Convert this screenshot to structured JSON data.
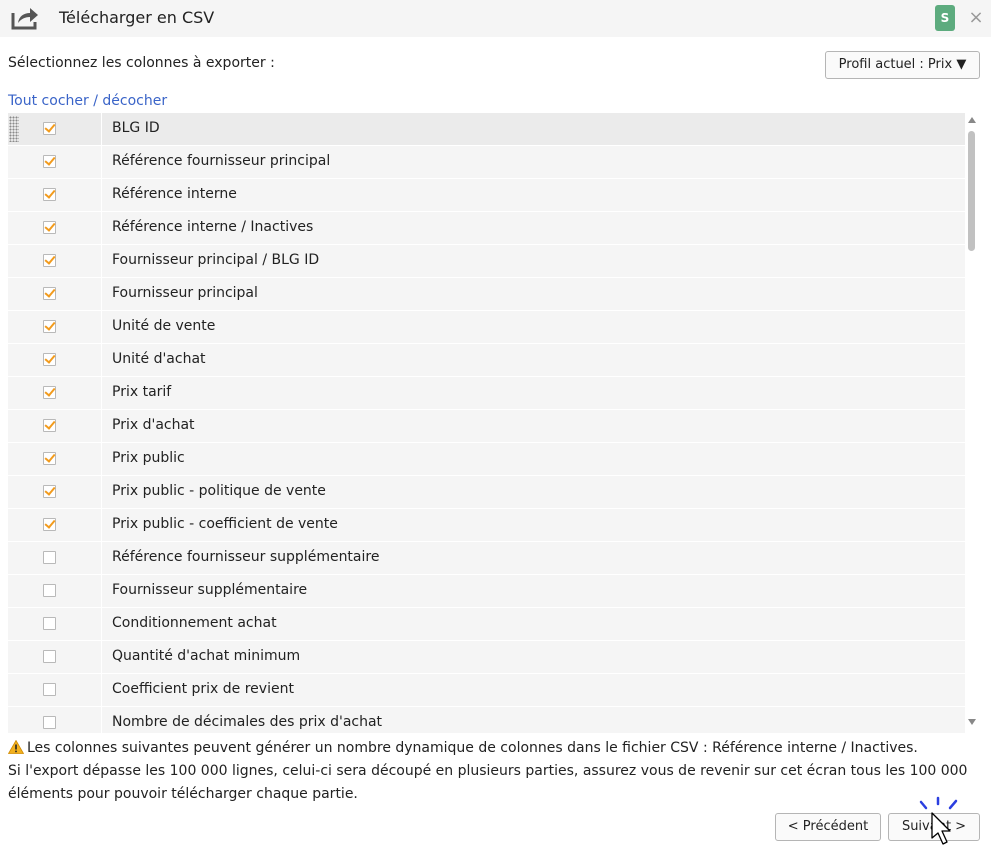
{
  "window": {
    "title": "Télécharger en CSV",
    "user_initial": "S",
    "close_glyph": "×",
    "title_icon": "export-icon",
    "colors": {
      "badge": "#5dab7e",
      "checkbox_check": "#f29b1d",
      "link": "#3a64c8"
    }
  },
  "header": {
    "select_label": "Sélectionnez les colonnes à exporter :",
    "profile_button": "Profil actuel : Prix ▼"
  },
  "toggle_all_link": "Tout cocher / décocher",
  "columns": [
    {
      "label": "BLG ID",
      "checked": true
    },
    {
      "label": "Référence fournisseur principal",
      "checked": true
    },
    {
      "label": "Référence interne",
      "checked": true
    },
    {
      "label": "Référence interne / Inactives",
      "checked": true
    },
    {
      "label": "Fournisseur principal / BLG ID",
      "checked": true
    },
    {
      "label": "Fournisseur principal",
      "checked": true
    },
    {
      "label": "Unité de vente",
      "checked": true
    },
    {
      "label": "Unité d'achat",
      "checked": true
    },
    {
      "label": "Prix tarif",
      "checked": true
    },
    {
      "label": "Prix d'achat",
      "checked": true
    },
    {
      "label": "Prix public",
      "checked": true
    },
    {
      "label": "Prix public - politique de vente",
      "checked": true
    },
    {
      "label": "Prix public - coefficient de vente",
      "checked": true
    },
    {
      "label": "Référence fournisseur supplémentaire",
      "checked": false
    },
    {
      "label": "Fournisseur supplémentaire",
      "checked": false
    },
    {
      "label": "Conditionnement achat",
      "checked": false
    },
    {
      "label": "Quantité d'achat minimum",
      "checked": false
    },
    {
      "label": "Coefficient prix de revient",
      "checked": false
    },
    {
      "label": "Nombre de décimales des prix d'achat",
      "checked": false
    }
  ],
  "warning": {
    "icon": "warning-icon",
    "text": "Les colonnes suivantes peuvent générer un nombre dynamique de colonnes dans le fichier CSV : Référence interne / Inactives."
  },
  "info_text": "Si l'export dépasse les 100 000 lignes, celui-ci sera découpé en plusieurs parties, assurez vous de revenir sur cet écran tous les 100 000 éléments pour pouvoir télécharger chaque partie.",
  "footer": {
    "prev_button": "< Précédent",
    "next_button": "Suivant >"
  }
}
